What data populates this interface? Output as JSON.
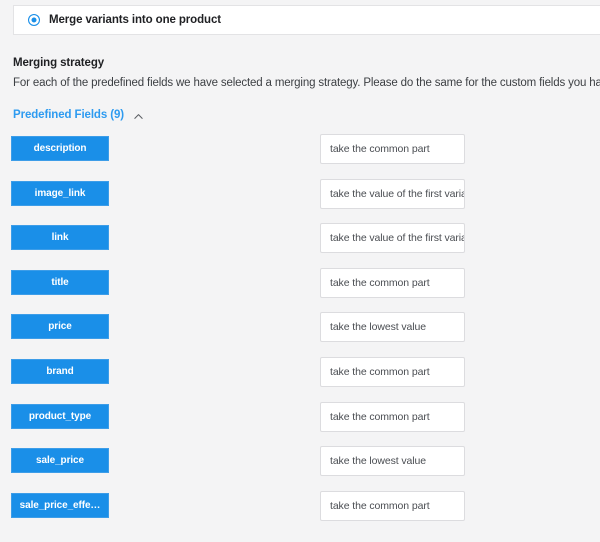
{
  "merge_option": {
    "label": "Merge variants into one product",
    "selected": true,
    "radio_icon": "radio-selected-icon"
  },
  "section": {
    "title": "Merging strategy",
    "description": "For each of the predefined fields we have selected a merging strategy. Please do the same for the custom fields you have added:"
  },
  "group": {
    "label": "Predefined Fields (9)",
    "expanded": true,
    "toggle_icon": "chevron-up-icon"
  },
  "colors": {
    "accent_blue": "#1a8fe8",
    "link_blue": "#2e9bf0",
    "page_bg": "#f4f4f5",
    "card_bg": "#ffffff",
    "input_border": "#dcdcdf",
    "text_dark": "#1f2023",
    "text_body": "#3c3f43",
    "text_input": "#4a4d52"
  },
  "fields": [
    {
      "name": "description",
      "strategy": "take the common part"
    },
    {
      "name": "image_link",
      "strategy": "take the value of the first variant"
    },
    {
      "name": "link",
      "strategy": "take the value of the first variant"
    },
    {
      "name": "title",
      "strategy": "take the common part"
    },
    {
      "name": "price",
      "strategy": "take the lowest value"
    },
    {
      "name": "brand",
      "strategy": "take the common part"
    },
    {
      "name": "product_type",
      "strategy": "take the common part"
    },
    {
      "name": "sale_price",
      "strategy": "take the lowest value"
    },
    {
      "name": "sale_price_effe…",
      "strategy": "take the common part"
    }
  ]
}
